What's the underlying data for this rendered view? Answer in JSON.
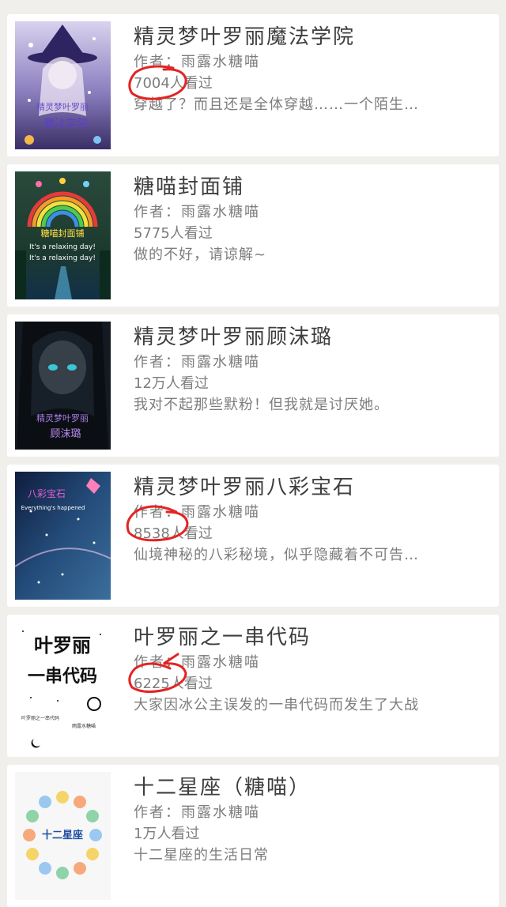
{
  "items": [
    {
      "title": "精灵梦叶罗丽魔法学院",
      "author": "作者：雨露水糖喵",
      "reads": "7004人看过",
      "desc": "穿越了？而且还是全体穿越……一个陌生…",
      "cover": {
        "label": "精灵梦叶罗丽 魔法学院",
        "colors": [
          "#6b5c9e",
          "#d9d2ee",
          "#3a2e66"
        ]
      },
      "annotated": true
    },
    {
      "title": "糖喵封面铺",
      "author": "作者：雨露水糖喵",
      "reads": "5775人看过",
      "desc": "做的不好，请谅解~",
      "cover": {
        "label": "糖喵封面铺",
        "subtitle": "It's a relaxing day!",
        "colors": [
          "#1f4a38",
          "#e94f7a",
          "#2a6fa6"
        ]
      },
      "annotated": false
    },
    {
      "title": "精灵梦叶罗丽顾沫璐",
      "author": "作者：雨露水糖喵",
      "reads": "12万人看过",
      "desc": "我对不起那些默粉！但我就是讨厌她。",
      "cover": {
        "label": "精灵梦叶罗丽 顾沫璐",
        "colors": [
          "#121821",
          "#3b4c5a",
          "#8f5fc0"
        ]
      },
      "annotated": false
    },
    {
      "title": "精灵梦叶罗丽八彩宝石",
      "author": "作者：雨露水糖喵",
      "reads": "8538人看过",
      "desc": "仙境神秘的八彩秘境，似乎隐藏着不可告…",
      "cover": {
        "label": "八彩宝石",
        "subtitle": "Everything's happened",
        "colors": [
          "#0f1d3e",
          "#2c5b8f",
          "#d45f9a"
        ]
      },
      "annotated": true
    },
    {
      "title": "叶罗丽之一串代码",
      "author": "作者：雨露水糖喵",
      "reads": "6225人看过",
      "desc": "大家因冰公主误发的一串代码而发生了大战",
      "cover": {
        "label": "叶罗丽 一串代码",
        "footer": "叶罗丽之一串代码",
        "colors": [
          "#ffffff",
          "#111111",
          "#444444"
        ]
      },
      "annotated": true
    },
    {
      "title": "十二星座（糖喵）",
      "author": "作者：雨露水糖喵",
      "reads": "1万人看过",
      "desc": "十二星座的生活日常",
      "cover": {
        "label": "十二星座",
        "colors": [
          "#f7f7f7",
          "#1e4fa0",
          "#e6c43a"
        ]
      },
      "annotated": false
    }
  ],
  "annotation_color": "#e32424"
}
